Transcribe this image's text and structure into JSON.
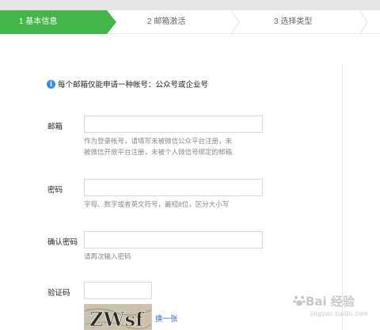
{
  "steps": [
    {
      "label": "1 基本信息",
      "active": true
    },
    {
      "label": "2 邮箱激活",
      "active": false
    },
    {
      "label": "3 选择类型",
      "active": false
    }
  ],
  "colors": {
    "accent": "#44b549",
    "link": "#2a6fbf",
    "info": "#2d8cf0"
  },
  "notice": {
    "icon": "info-icon",
    "text": "每个邮箱仅能申请一种帐号：公众号或企业号"
  },
  "form": {
    "email": {
      "label": "邮箱",
      "value": "",
      "hint_line1": "作为登录帐号，请填写未被微信公众平台注册，未",
      "hint_line2": "被微信开放平台注册，未被个人微信号绑定的邮箱"
    },
    "password": {
      "label": "密码",
      "value": "",
      "hint": "字母、数字或者英文符号，最短8位，区分大小写"
    },
    "confirm": {
      "label": "确认密码",
      "value": "",
      "hint": "请再次输入密码"
    },
    "captcha": {
      "label": "验证码",
      "value": "",
      "image_text": "ZWsf",
      "refresh_link": "换一张"
    }
  },
  "watermark": {
    "brand": "Bai 经验",
    "sub": "jingyan.baidu.com"
  }
}
